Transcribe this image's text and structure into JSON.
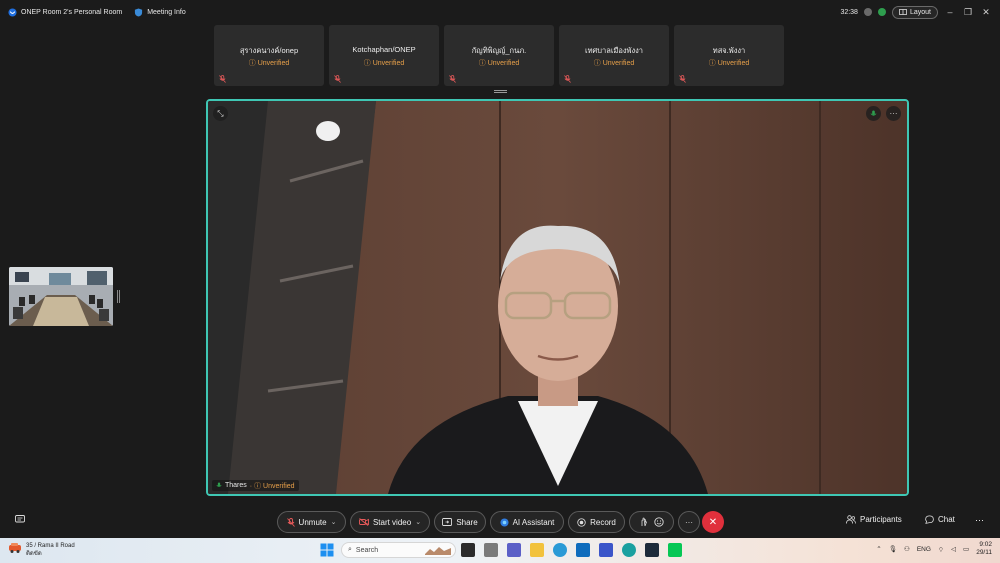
{
  "window": {
    "room_title": "ONEP Room 2's Personal Room",
    "meeting_info": "Meeting Info",
    "timer": "32:38",
    "layout_label": "Layout"
  },
  "participants": [
    {
      "name": "สุรางคนางค์/onep",
      "status": "Unverified"
    },
    {
      "name": "Kotchaphan/ONEP",
      "status": "Unverified"
    },
    {
      "name": "กัญทิพิญญ์_กนภ.",
      "status": "Unverified"
    },
    {
      "name": "เทศบาลเมืองพังงา",
      "status": "Unverified"
    },
    {
      "name": "ทสจ.พังงา",
      "status": "Unverified"
    }
  ],
  "main_video": {
    "speaker_name": "Thares",
    "speaker_status": "Unverified"
  },
  "toolbar": {
    "unmute": "Unmute",
    "start_video": "Start video",
    "share": "Share",
    "ai_assistant": "AI Assistant",
    "record": "Record",
    "participants": "Participants",
    "chat": "Chat"
  },
  "taskbar": {
    "weather_line1": "35 / Rama II Road",
    "weather_line2": "ติดขัด",
    "search_placeholder": "Search",
    "language": "ENG",
    "time": "9:02",
    "date": "29/11"
  },
  "colors": {
    "accent_border": "#3fc7b4",
    "unverified": "#e7a04a",
    "leave_button": "#e0303c",
    "muted_icon": "#e85a5a"
  }
}
